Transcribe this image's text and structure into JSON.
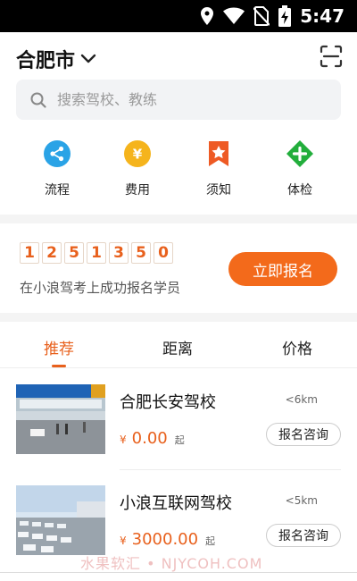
{
  "status_bar": {
    "time": "5:47"
  },
  "header": {
    "city": "合肥市"
  },
  "search": {
    "placeholder": "搜索驾校、教练"
  },
  "quick_actions": [
    {
      "label": "流程",
      "icon": "share-icon",
      "color": "#2aa3e6"
    },
    {
      "label": "费用",
      "icon": "yen-icon",
      "color": "#f5b41c"
    },
    {
      "label": "须知",
      "icon": "bookmark-star-icon",
      "color": "#ee5a24"
    },
    {
      "label": "体检",
      "icon": "medical-plus-icon",
      "color": "#22ae3c"
    }
  ],
  "registration": {
    "digits": [
      "1",
      "2",
      "5",
      "1",
      "3",
      "5",
      "0"
    ],
    "text": "在小浪驾考上成功报名学员",
    "button": "立即报名"
  },
  "tabs": [
    {
      "label": "推荐",
      "active": true
    },
    {
      "label": "距离",
      "active": false
    },
    {
      "label": "价格",
      "active": false
    }
  ],
  "schools": [
    {
      "name": "合肥长安驾校",
      "distance": "<6km",
      "currency": "¥",
      "price": "0.00",
      "unit": "起",
      "button": "报名咨询"
    },
    {
      "name": "小浪互联网驾校",
      "distance": "<5km",
      "currency": "¥",
      "price": "3000.00",
      "unit": "起",
      "button": "报名咨询"
    }
  ],
  "watermark": "水果软汇 • NJYCOH.COM",
  "colors": {
    "accent": "#e8601c",
    "button": "#f36a1b"
  }
}
